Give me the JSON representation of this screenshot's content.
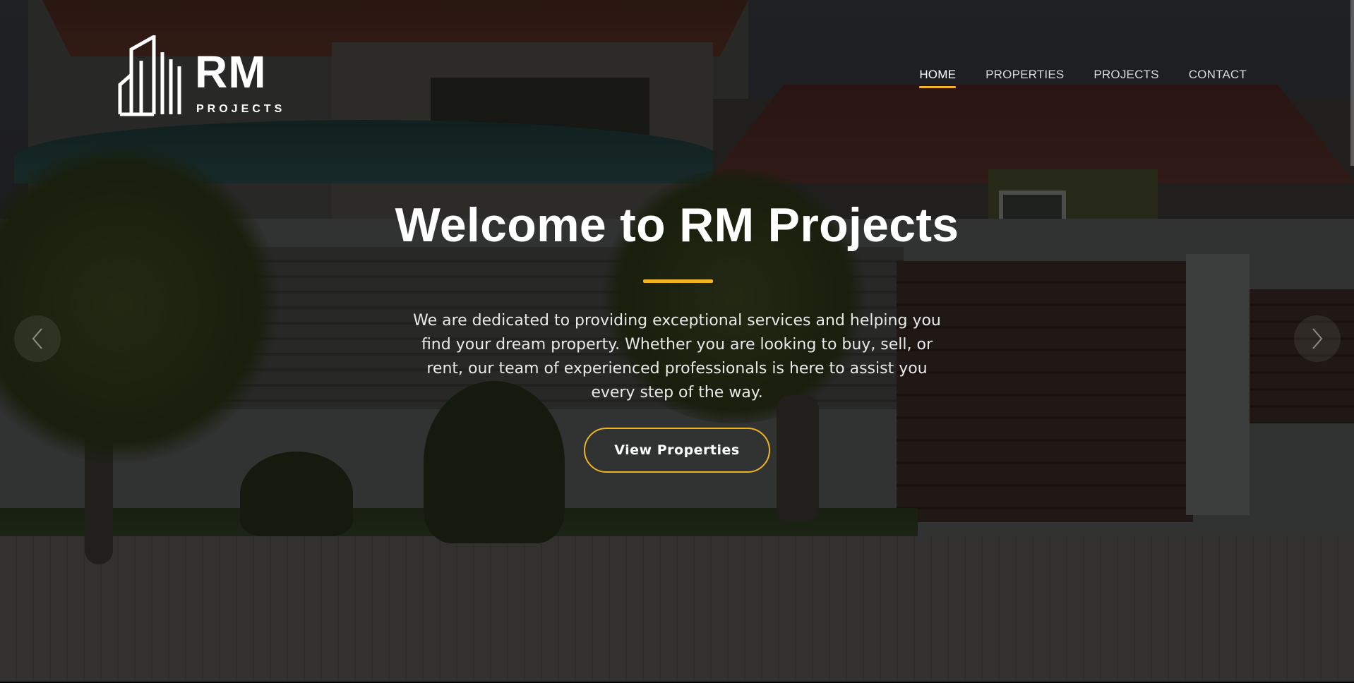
{
  "brand": {
    "logo_main": "RM",
    "logo_sub": "PROJECTS"
  },
  "nav": {
    "items": [
      {
        "label": "HOME",
        "active": true
      },
      {
        "label": "PROPERTIES",
        "active": false
      },
      {
        "label": "PROJECTS",
        "active": false
      },
      {
        "label": "CONTACT",
        "active": false
      }
    ]
  },
  "hero": {
    "title": "Welcome to RM Projects",
    "description": "We are dedicated to providing exceptional services and helping you find your dream property. Whether you are looking to buy, sell, or rent, our team of experienced professionals is here to assist you every step of the way.",
    "cta_label": "View Properties"
  },
  "carousel": {
    "prev_icon": "chevron-left-icon",
    "next_icon": "chevron-right-icon"
  },
  "colors": {
    "accent": "#f0b321",
    "text": "#ffffff"
  }
}
